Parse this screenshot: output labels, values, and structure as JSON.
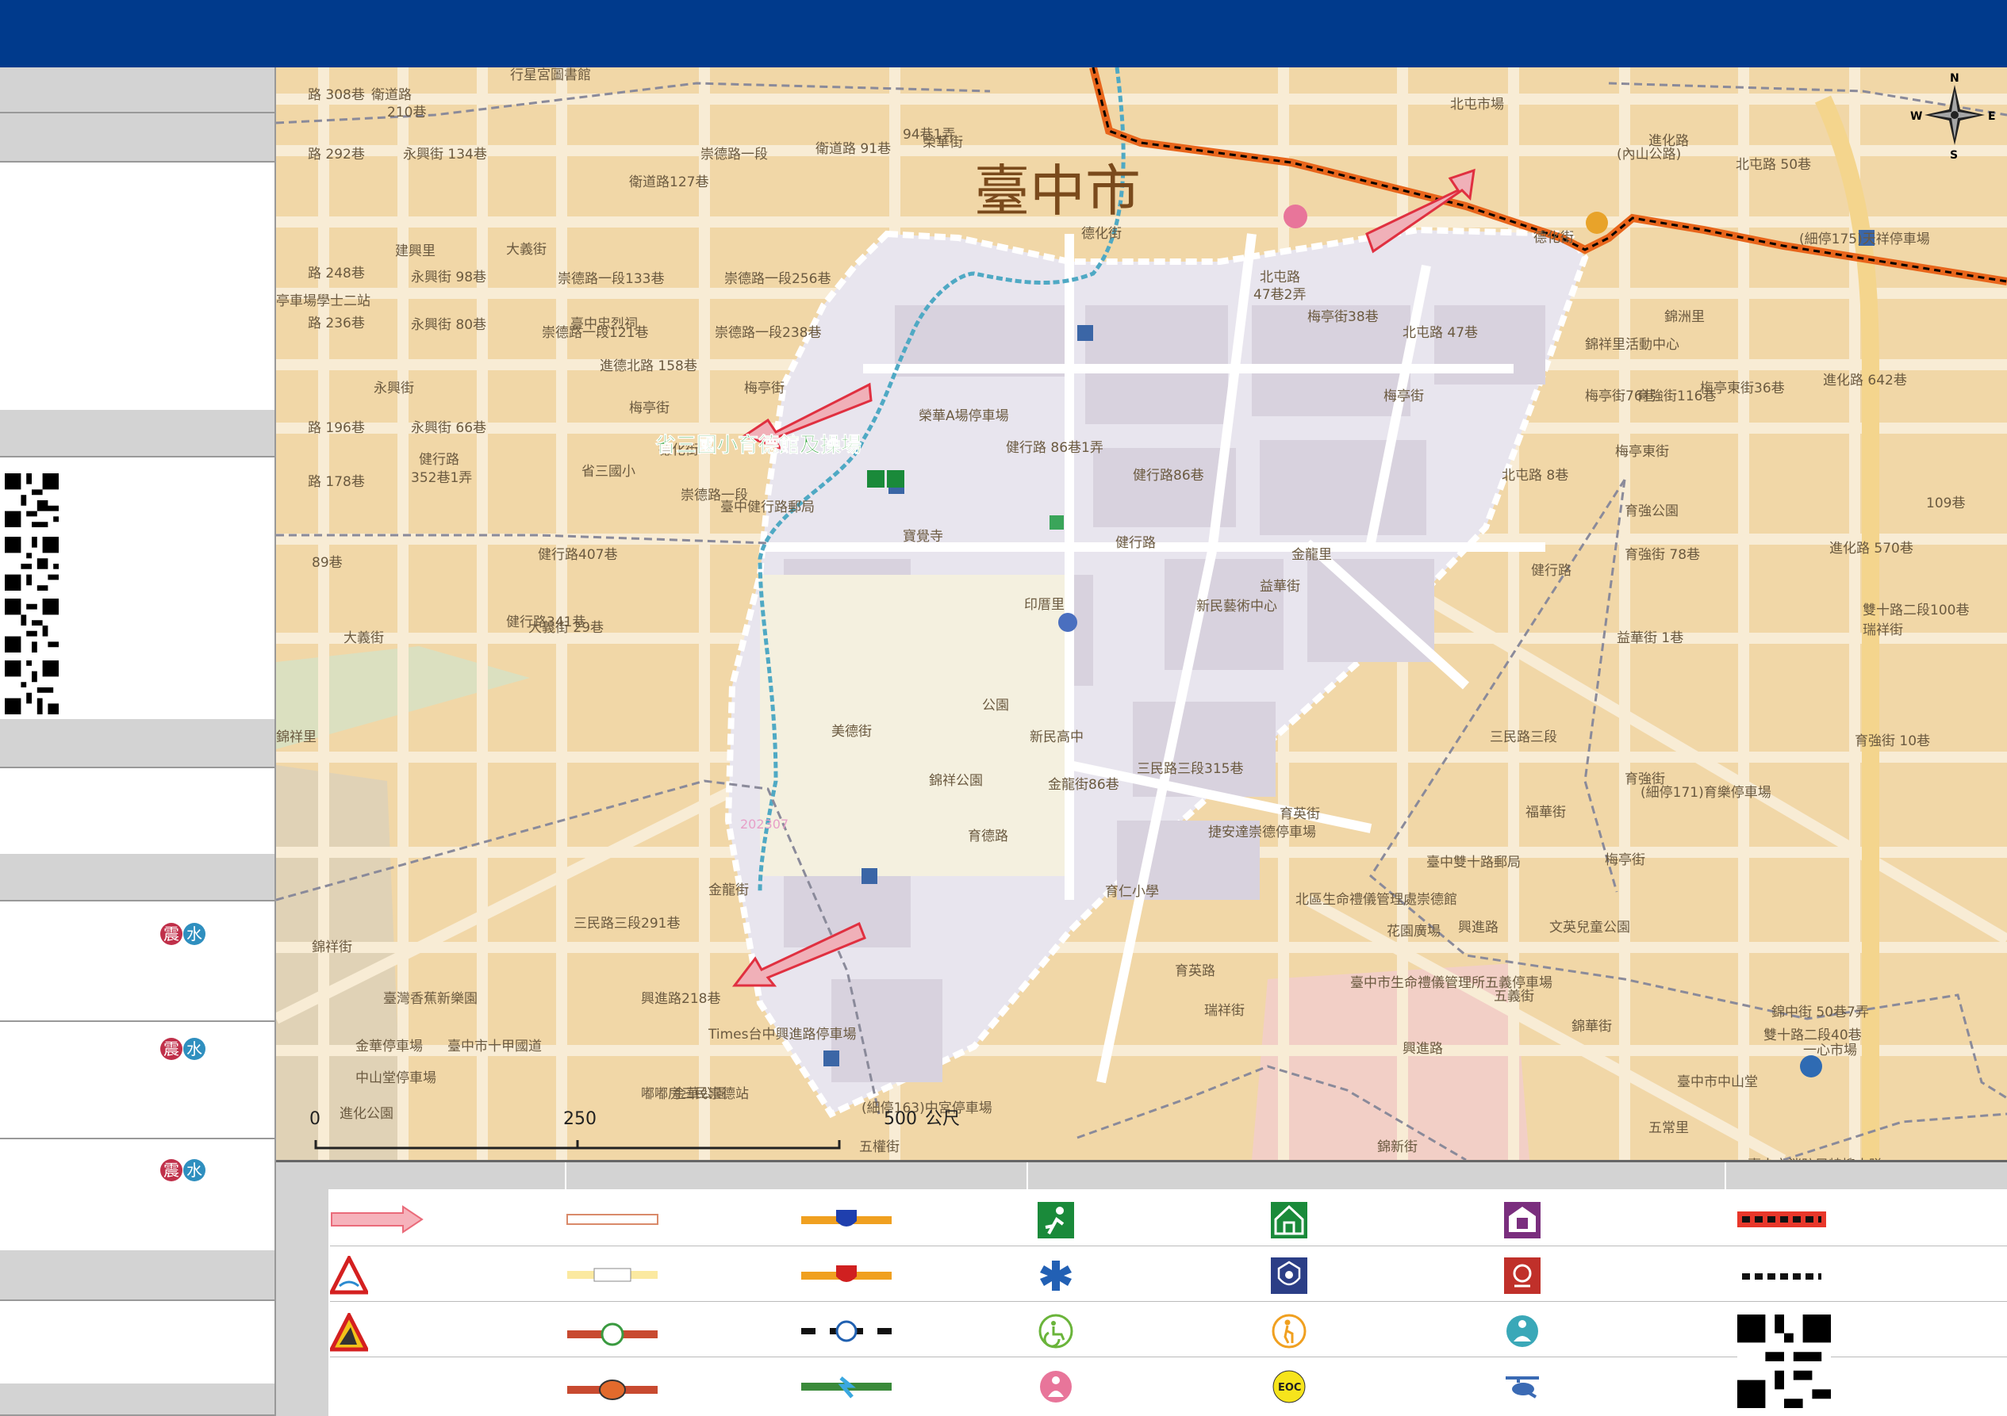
{
  "map": {
    "city_name": "臺中市",
    "shelter_label": "省三國小育德館及操場",
    "compass": {
      "n": "N",
      "s": "S",
      "e": "E",
      "w": "W"
    },
    "scale": {
      "t0": "0",
      "t1": "250",
      "t2": "500",
      "unit": "公尺"
    },
    "stamp": "202307",
    "labels": [
      {
        "t": "路 308巷"
      },
      {
        "t": "衛道路"
      },
      {
        "t": "210巷"
      },
      {
        "t": "行星宮圖書館"
      },
      {
        "t": "路 292巷"
      },
      {
        "t": "永興街 134巷"
      },
      {
        "t": "衛道路127巷"
      },
      {
        "t": "崇德路一段"
      },
      {
        "t": "衛道路 91巷"
      },
      {
        "t": "94巷1弄"
      },
      {
        "t": "榮華街"
      },
      {
        "t": "北屯市場"
      },
      {
        "t": "進化路"
      },
      {
        "t": "(內山公路)"
      },
      {
        "t": "北屯路 50巷"
      },
      {
        "t": "德化街"
      },
      {
        "t": "建興里"
      },
      {
        "t": "大義街"
      },
      {
        "t": "路 248巷"
      },
      {
        "t": "永興街 98巷"
      },
      {
        "t": "崇德路一段133巷"
      },
      {
        "t": "崇德路一段256巷"
      },
      {
        "t": "亭車場學士二站"
      },
      {
        "t": "路 236巷"
      },
      {
        "t": "永興街 80巷"
      },
      {
        "t": "崇德路一段121巷"
      },
      {
        "t": "崇德路一段238巷"
      },
      {
        "t": "梅亭街"
      },
      {
        "t": "永興街"
      },
      {
        "t": "路 196巷"
      },
      {
        "t": "永興街 66巷"
      },
      {
        "t": "健行路"
      },
      {
        "t": "352巷1弄"
      },
      {
        "t": "路 178巷"
      },
      {
        "t": "省三國小"
      },
      {
        "t": "崇德路一段"
      },
      {
        "t": "榮華A場停車場"
      },
      {
        "t": "健行路 86巷1弄"
      },
      {
        "t": "北屯路"
      },
      {
        "t": "47巷2弄"
      },
      {
        "t": "梅亭街38巷"
      },
      {
        "t": "北屯路 47巷"
      },
      {
        "t": "梅亭街"
      },
      {
        "t": "健行路86巷"
      },
      {
        "t": "德化街"
      },
      {
        "t": "錦祥里活動中心"
      },
      {
        "t": "錦洲里"
      },
      {
        "t": "進化路 642巷"
      },
      {
        "t": "(細停175)天祥停車場"
      },
      {
        "t": "梅亭街76巷"
      },
      {
        "t": "育強街116巷"
      },
      {
        "t": "梅亭東街36巷"
      },
      {
        "t": "梅亭東街"
      },
      {
        "t": "北屯路 8巷"
      },
      {
        "t": "育強公園"
      },
      {
        "t": "育強街 78巷"
      },
      {
        "t": "進化路 570巷"
      },
      {
        "t": "109巷"
      },
      {
        "t": "臺中健行路郵局"
      },
      {
        "t": "寶覺寺"
      },
      {
        "t": "健行路"
      },
      {
        "t": "金龍里"
      },
      {
        "t": "健行路"
      },
      {
        "t": "雙十路二段100巷"
      },
      {
        "t": "瑞祥街"
      },
      {
        "t": "89巷"
      },
      {
        "t": "健行路407巷"
      },
      {
        "t": "健行路341巷"
      },
      {
        "t": "大義街 29巷"
      },
      {
        "t": "大義街"
      },
      {
        "t": "印厝里"
      },
      {
        "t": "新民藝術中心"
      },
      {
        "t": "益華街"
      },
      {
        "t": "益華街 1巷"
      },
      {
        "t": "錦祥里"
      },
      {
        "t": "美德街"
      },
      {
        "t": "公園"
      },
      {
        "t": "新民高中"
      },
      {
        "t": "金龍街86巷"
      },
      {
        "t": "三民路三段315巷"
      },
      {
        "t": "三民路三段"
      },
      {
        "t": "福華街"
      },
      {
        "t": "(細停171)育樂停車場"
      },
      {
        "t": "育強街 10巷"
      },
      {
        "t": "育強街"
      },
      {
        "t": "育英街"
      },
      {
        "t": "錦祥公園"
      },
      {
        "t": "育德路"
      },
      {
        "t": "臺中雙十路郵局"
      },
      {
        "t": "梅亭街"
      },
      {
        "t": "金龍街"
      },
      {
        "t": "三民路三段291巷"
      },
      {
        "t": "錦祥街"
      },
      {
        "t": "育仁小學"
      },
      {
        "t": "捷安達崇德停車場"
      },
      {
        "t": "北區生命禮儀管理處崇德館"
      },
      {
        "t": "花園廣場"
      },
      {
        "t": "文英兒童公園"
      },
      {
        "t": "興進路"
      },
      {
        "t": "臺灣香蕉新樂園"
      },
      {
        "t": "興進路218巷"
      },
      {
        "t": "育英路"
      },
      {
        "t": "瑞祥街"
      },
      {
        "t": "臺中市生命禮儀管理所五義停車場"
      },
      {
        "t": "五義街"
      },
      {
        "t": "錦華街"
      },
      {
        "t": "錦中街 50巷7弄"
      },
      {
        "t": "雙十路二段40巷"
      },
      {
        "t": "金華停車場"
      },
      {
        "t": "臺中市十甲國道"
      },
      {
        "t": "Times台中興進路停車場"
      },
      {
        "t": "興進路"
      },
      {
        "t": "臺中市中山堂"
      },
      {
        "t": "中山堂停車場"
      },
      {
        "t": "嘟嘟房三民崇德站"
      },
      {
        "t": "金華公園"
      },
      {
        "t": "進化公園"
      },
      {
        "t": "(細停163)中宮停車場"
      },
      {
        "t": "五權街"
      },
      {
        "t": "錦新街"
      },
      {
        "t": "五常里"
      },
      {
        "t": "一心市場"
      },
      {
        "t": "臺中市消防局特搜大隊"
      },
      {
        "t": "臺中忠烈祠"
      },
      {
        "t": "進德北路 158巷"
      },
      {
        "t": "梅亭街"
      },
      {
        "t": "德化街"
      }
    ]
  }
}
